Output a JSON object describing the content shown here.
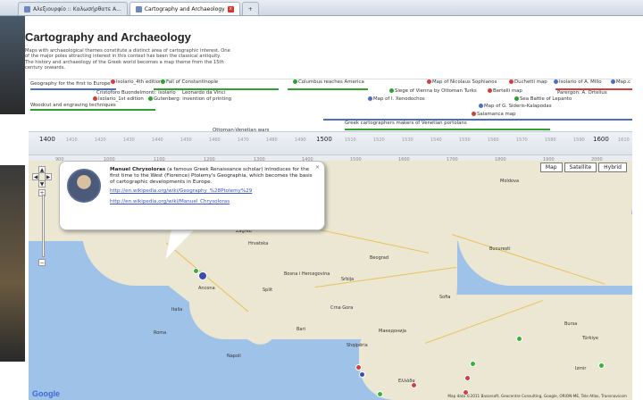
{
  "browser": {
    "tabs": [
      {
        "label": "Αλεξιουρφίο :: Καλωσήρθατε Α..."
      },
      {
        "label": "Cartography and Archaeology"
      }
    ],
    "new_tab": "+"
  },
  "page": {
    "title": "Cartography and Archaeology",
    "intro": "Maps with archaeological themes constitute a distinct area of cartographic interest. One of the major poles attracting interest in this context has been the classical antiquity. The history and archaeology of the Greek world becomes a map theme from the 15th century onwards."
  },
  "timeline": {
    "events": [
      {
        "label": "Geography for the first to Europe",
        "color": "#4a70c0"
      },
      {
        "label": "Isolario_4th edition",
        "color": "#d04040"
      },
      {
        "label": "Fall of Constantinople",
        "color": "#30a030"
      },
      {
        "label": "Columbus reaches America",
        "color": "#30a030"
      },
      {
        "label": "Map of Nicolaus Sophianos",
        "color": "#d04040"
      },
      {
        "label": "Duchetti map",
        "color": "#d04040"
      },
      {
        "label": "Isolario of A. Millo",
        "color": "#4a70c0"
      },
      {
        "label": "Map.c",
        "color": "#4a70c0"
      },
      {
        "label": "Cristoforo Buondelmonti: Isolario",
        "color": ""
      },
      {
        "label": "Leonardo da Vinci",
        "color": ""
      },
      {
        "label": "Siege of Vienna by Ottoman Turks",
        "color": "#30a030"
      },
      {
        "label": "Bertelli map",
        "color": "#d04040"
      },
      {
        "label": "Parergon: A. Ortelius",
        "color": ""
      },
      {
        "label": "Isolario_1st edition",
        "color": "#d04040"
      },
      {
        "label": "Gutenberg: invention of printing",
        "color": "#30a030"
      },
      {
        "label": "Map of I. Xenodochos",
        "color": "#4a70c0"
      },
      {
        "label": "Sea Battle of Lepanto",
        "color": "#30a030"
      },
      {
        "label": "Woodcut and engraving techniques",
        "color": ""
      },
      {
        "label": "Map of G. Sideris-Kalapodas",
        "color": "#4a70c0"
      },
      {
        "label": "Salamanca map",
        "color": "#d04040"
      },
      {
        "label": "Greek cartographers makers of Venetian portolans",
        "color": ""
      },
      {
        "label": "Ottoman-Venetian wars",
        "color": ""
      }
    ],
    "years": [
      "1400",
      "1410",
      "1420",
      "1430",
      "1440",
      "1450",
      "1460",
      "1470",
      "1480",
      "1490",
      "1500",
      "1510",
      "1520",
      "1530",
      "1540",
      "1550",
      "1560",
      "1570",
      "1580",
      "1590",
      "1600",
      "1610"
    ],
    "big_years": [
      "1400",
      "1500",
      "1600"
    ],
    "decades": [
      "900",
      "1000",
      "1100",
      "1200",
      "1300",
      "1400",
      "1500",
      "1600",
      "1700",
      "1800",
      "1900",
      "2000"
    ]
  },
  "map": {
    "types": [
      "Map",
      "Satellite",
      "Hybrid"
    ],
    "labels": [
      {
        "t": "Moldova"
      },
      {
        "t": "Hrvatska"
      },
      {
        "t": "Srbija"
      },
      {
        "t": "Bosna i Hercegovina"
      },
      {
        "t": "Crna Gora"
      },
      {
        "t": "Shqipëria"
      },
      {
        "t": "Македонија"
      },
      {
        "t": "Ελλάδα"
      },
      {
        "t": "Italia"
      },
      {
        "t": "Roma"
      },
      {
        "t": "Napoli"
      },
      {
        "t": "București"
      },
      {
        "t": "Sofia"
      },
      {
        "t": "Beograd"
      },
      {
        "t": "Bari"
      },
      {
        "t": "Izmir"
      },
      {
        "t": "Türkiye"
      },
      {
        "t": "Bursa"
      },
      {
        "t": "Ancona"
      },
      {
        "t": "Split"
      },
      {
        "t": "Zagreb"
      }
    ],
    "bubble": {
      "name": "Manuel Chrysoloras",
      "text": " (a famous Greek Renaissance scholar) introduces for the first time to the West (Florence) Ptolemy's Geographia, which becomes the basis of cartographic developments in Europe.",
      "link1": "http://en.wikipedia.org/wiki/Geography_%28Ptolemy%29",
      "link2": "http://en.wikipedia.org/wiki/Manuel_Chrysoloras",
      "close": "×"
    },
    "google": "Google",
    "mapdata": "Map data ©2011 Basarsoft, Geocentre Consulting, Google, ORION-ME, Tele Atlas, Transnavicom"
  }
}
